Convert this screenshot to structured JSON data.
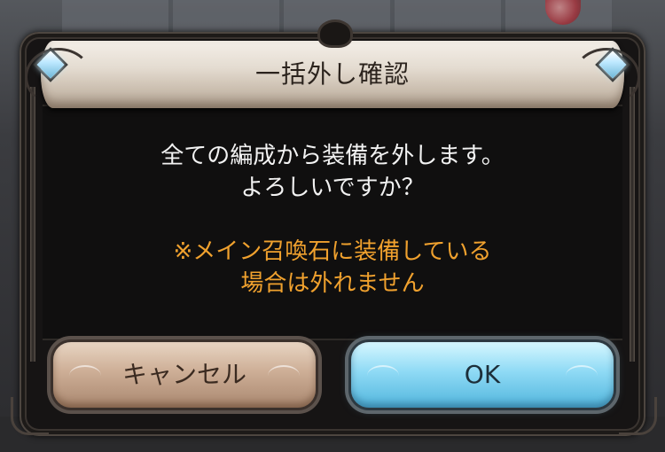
{
  "dialog": {
    "title": "一括外し確認",
    "message_line1": "全ての編成から装備を外します。",
    "message_line2": "よろしいですか？",
    "note_line1": "※メイン召喚石に装備している",
    "note_line2": "場合は外れません"
  },
  "buttons": {
    "cancel_label": "キャンセル",
    "ok_label": "OK"
  },
  "colors": {
    "note_text": "#f0a12e",
    "cancel_button": "#cdae96",
    "ok_button": "#8fdaf5"
  },
  "icons": {
    "corner_gems": "diamond-gem-icon"
  }
}
